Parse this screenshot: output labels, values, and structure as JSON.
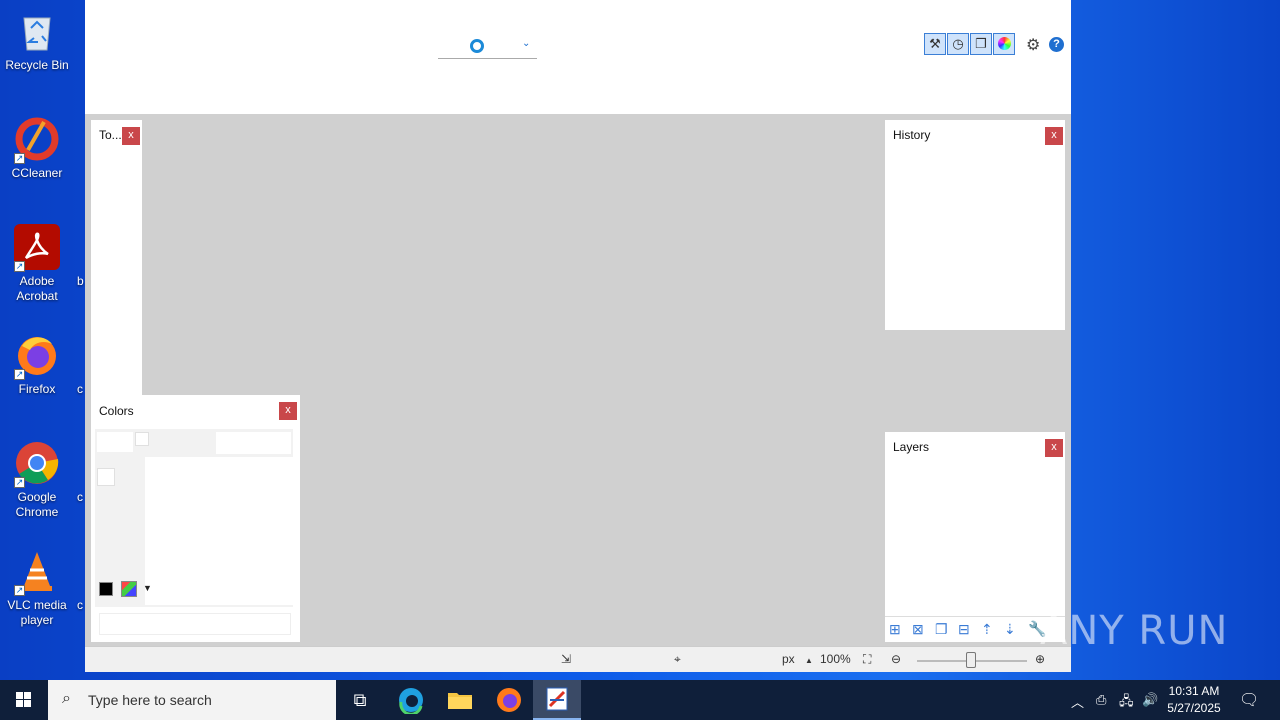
{
  "desktop": {
    "icons": [
      {
        "label": "Recycle Bin"
      },
      {
        "label": "CCleaner"
      },
      {
        "label": "Adobe Acrobat"
      },
      {
        "label": "Firefox"
      },
      {
        "label": "Google Chrome"
      },
      {
        "label": "VLC media player"
      }
    ],
    "partial_labels": [
      "b",
      "c",
      "c",
      "c"
    ]
  },
  "app": {
    "panels": {
      "tools": {
        "title": "To...",
        "close": "x"
      },
      "colors": {
        "title": "Colors",
        "close": "x"
      },
      "history": {
        "title": "History",
        "close": "x"
      },
      "layers": {
        "title": "Layers",
        "close": "x"
      }
    },
    "status": {
      "unit": "px",
      "zoom": "100%"
    }
  },
  "taskbar": {
    "search_placeholder": "Type here to search",
    "time": "10:31 AM",
    "date": "5/27/2025"
  },
  "watermark": "ANY RUN",
  "colors": {
    "accent": "#1c8ad8",
    "close_button": "#c9474a",
    "workspace": "#d0d0d0",
    "taskbar": "#0f1f3a"
  }
}
